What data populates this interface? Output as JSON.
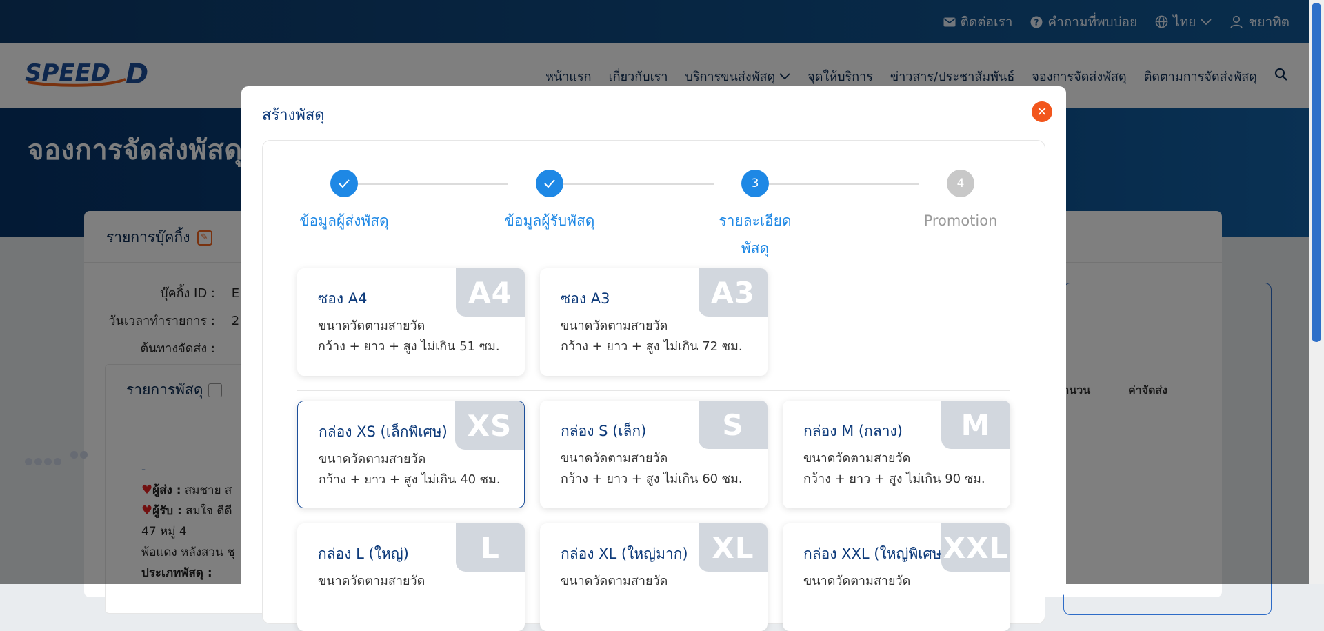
{
  "topbar": {
    "contact": "ติดต่อเรา",
    "faq": "คำถามที่พบบ่อย",
    "language": "ไทย",
    "user": "ชยาทิต"
  },
  "header": {
    "logo_text": "SPEED",
    "logo_d": "D",
    "nav": [
      {
        "label": "หน้าแรก"
      },
      {
        "label": "เกี่ยวกับเรา"
      },
      {
        "label": "บริการขนส่งพัสดุ"
      },
      {
        "label": "จุดให้บริการ"
      },
      {
        "label": "ข่าวสาร/ประชาสัมพันธ์"
      },
      {
        "label": "จองการจัดส่งพัสดุ"
      },
      {
        "label": "ติดตามการจัดส่งพัสดุ"
      }
    ]
  },
  "hero": {
    "title": "จองการจัดส่งพัสดุ"
  },
  "booking": {
    "title": "รายการบุ๊คกิ้ง",
    "booking_id_label": "บุ๊คกิ้ง ID :",
    "booking_id_value": "E",
    "datetime_label": "วันเวลาทำรายการ :",
    "datetime_value": "2",
    "origin_label": "ต้นทางจัดส่ง :",
    "items_title": "รายการพัสดุ",
    "col_qty": "จำนวน",
    "col_fee": "ค่าจัดส่ง",
    "dash": "-",
    "sender_label": "ผู้ส่ง :",
    "sender_value": "สมชาย ส",
    "receiver_label": "ผู้รับ :",
    "receiver_value": "สมใจ ดีดี",
    "address1": "47 หมู่ 4",
    "address2": "พ้อแดง หลังสวน ชุ",
    "parcel_type_label": "ประเภทพัสดุ :"
  },
  "modal": {
    "title": "สร้างพัสดุ",
    "steps": [
      {
        "number": "1",
        "label": "ข้อมูลผู้ส่งพัสดุ",
        "status": "done"
      },
      {
        "number": "2",
        "label": "ข้อมูลผู้รับพัสดุ",
        "status": "done"
      },
      {
        "number": "3",
        "label": "รายละเอียดพัสดุ",
        "status": "active"
      },
      {
        "number": "4",
        "label": "Promotion",
        "status": "pending"
      }
    ],
    "envelopes": [
      {
        "badge": "A4",
        "name": "ซอง A4",
        "measure": "ขนาดวัดตามสายวัด",
        "limit": "กว้าง + ยาว + สูง ไม่เกิน 51 ซม."
      },
      {
        "badge": "A3",
        "name": "ซอง A3",
        "measure": "ขนาดวัดตามสายวัด",
        "limit": "กว้าง + ยาว + สูง ไม่เกิน 72 ซม."
      }
    ],
    "boxes": [
      {
        "badge": "XS",
        "name": "กล่อง XS (เล็กพิเศษ)",
        "measure": "ขนาดวัดตามสายวัด",
        "limit": "กว้าง + ยาว + สูง ไม่เกิน 40 ซม.",
        "selected": true
      },
      {
        "badge": "S",
        "name": "กล่อง S (เล็ก)",
        "measure": "ขนาดวัดตามสายวัด",
        "limit": "กว้าง + ยาว + สูง ไม่เกิน 60 ซม."
      },
      {
        "badge": "M",
        "name": "กล่อง M (กลาง)",
        "measure": "ขนาดวัดตามสายวัด",
        "limit": "กว้าง + ยาว + สูง ไม่เกิน 90 ซม."
      },
      {
        "badge": "L",
        "name": "กล่อง L (ใหญ่)",
        "measure": "ขนาดวัดตามสายวัด",
        "limit": ""
      },
      {
        "badge": "XL",
        "name": "กล่อง XL (ใหญ่มาก)",
        "measure": "ขนาดวัดตามสายวัด",
        "limit": ""
      },
      {
        "badge": "XXL",
        "name": "กล่อง XXL (ใหญ่พิเศษ",
        "measure": "ขนาดวัดตามสายวัด",
        "limit": ""
      }
    ]
  },
  "colors": {
    "primary": "#1e88e5",
    "navy": "#0d3a7a",
    "close": "#f2561d",
    "badge": "#d2d7de"
  }
}
